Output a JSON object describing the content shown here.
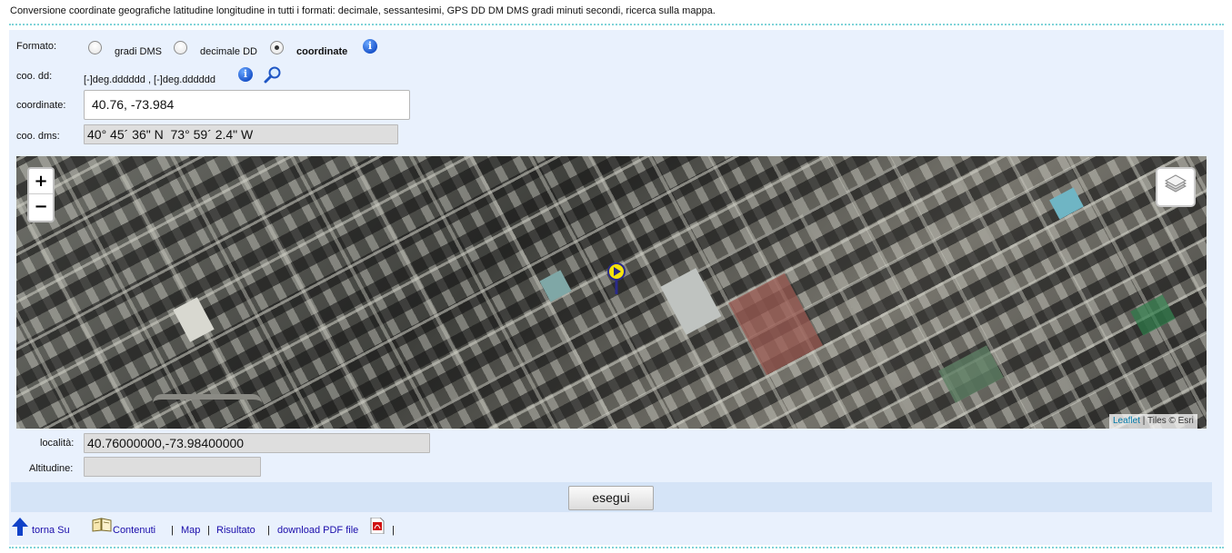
{
  "header": {
    "description": "Conversione coordinate geografiche latitudine longitudine in tutti i formati: decimale, sessantesimi, GPS DD DM DMS gradi minuti secondi, ricerca sulla mappa."
  },
  "form": {
    "formato_label": "Formato:",
    "format_options": [
      {
        "label": "gradi DMS",
        "checked": false
      },
      {
        "label": "decimale DD",
        "checked": false
      },
      {
        "label": "coordinate",
        "checked": true
      }
    ],
    "coo_dd_label": "coo. dd:",
    "coo_dd_hint": "[-]deg.dddddd , [-]deg.dddddd",
    "coordinate_label": "coordinate:",
    "coordinate_value": "40.76, -73.984",
    "coo_dms_label": "coo. dms:",
    "coo_dms_value": "40° 45´ 36\" N  73° 59´ 2.4\" W",
    "localita_label": "località:",
    "localita_value": "40.76000000,-73.98400000",
    "altitudine_label": "Altitudine:",
    "altitudine_value": ""
  },
  "map": {
    "zoom_in": "+",
    "zoom_out": "−",
    "attribution_link": "Leaflet",
    "attribution_rest": " | Tiles © Esri",
    "marker_color": "#f5e20b"
  },
  "actions": {
    "go_label": "esegui"
  },
  "footer": {
    "torna_su": "torna Su",
    "contenuti": "Contenuti",
    "map": "Map",
    "risultato": "Risultato",
    "download": "download PDF file",
    "separator": "|"
  },
  "colors": {
    "panel_bg": "#e9f1fd",
    "button_bar_bg": "#d5e4f7",
    "dotted_rule": "#7fd3d8",
    "link": "#1a0dab"
  },
  "icons": [
    "info-icon",
    "magnifier-icon",
    "layers-icon",
    "map-pin-icon",
    "up-arrow-icon",
    "book-icon",
    "pdf-icon"
  ]
}
